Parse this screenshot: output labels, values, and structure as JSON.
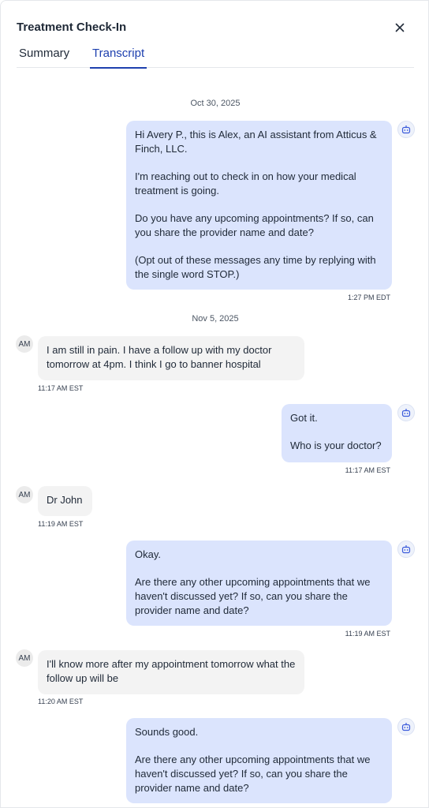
{
  "header": {
    "title": "Treatment Check-In",
    "close_label": "close"
  },
  "tabs": [
    {
      "label": "Summary",
      "active": false
    },
    {
      "label": "Transcript",
      "active": true
    }
  ],
  "colors": {
    "accent": "#1e40af",
    "outgoing_bubble": "#dbe4fd",
    "incoming_bubble": "#f3f3f3"
  },
  "transcript": {
    "dates": [
      "Oct 30, 2025",
      "Nov 5, 2025"
    ],
    "messages": [
      {
        "sender": "assistant",
        "text": "Hi Avery P., this is Alex, an AI assistant from Atticus & Finch, LLC.\n\nI'm reaching out to check in on how your medical treatment is going.\n\nDo you have any upcoming appointments? If so, can you share the provider name and date?\n\n(Opt out of these messages any time by replying with the single word STOP.)",
        "time": "1:27 PM EDT",
        "icon": "robot-icon"
      },
      {
        "sender": "client",
        "initials": "AM",
        "text": "I am still in pain. I have a follow up with my doctor tomorrow at 4pm. I think I go to banner hospital",
        "time": "11:17 AM EST"
      },
      {
        "sender": "assistant",
        "text": "Got it.\n\nWho is your doctor?",
        "time": "11:17 AM EST",
        "icon": "robot-icon"
      },
      {
        "sender": "client",
        "initials": "AM",
        "text": "Dr John",
        "time": "11:19 AM EST"
      },
      {
        "sender": "assistant",
        "text": "Okay.\n\nAre there any other upcoming appointments that we haven't discussed yet? If so, can you share the provider name and date?",
        "time": "11:19 AM EST",
        "icon": "robot-icon"
      },
      {
        "sender": "client",
        "initials": "AM",
        "text": "I'll know more after my appointment tomorrow what the follow up will be",
        "time": "11:20 AM EST"
      },
      {
        "sender": "assistant",
        "text": "Sounds good.\n\nAre there any other upcoming appointments that we haven't discussed yet? If so, can you share the provider name and date?",
        "icon": "robot-icon"
      }
    ]
  }
}
